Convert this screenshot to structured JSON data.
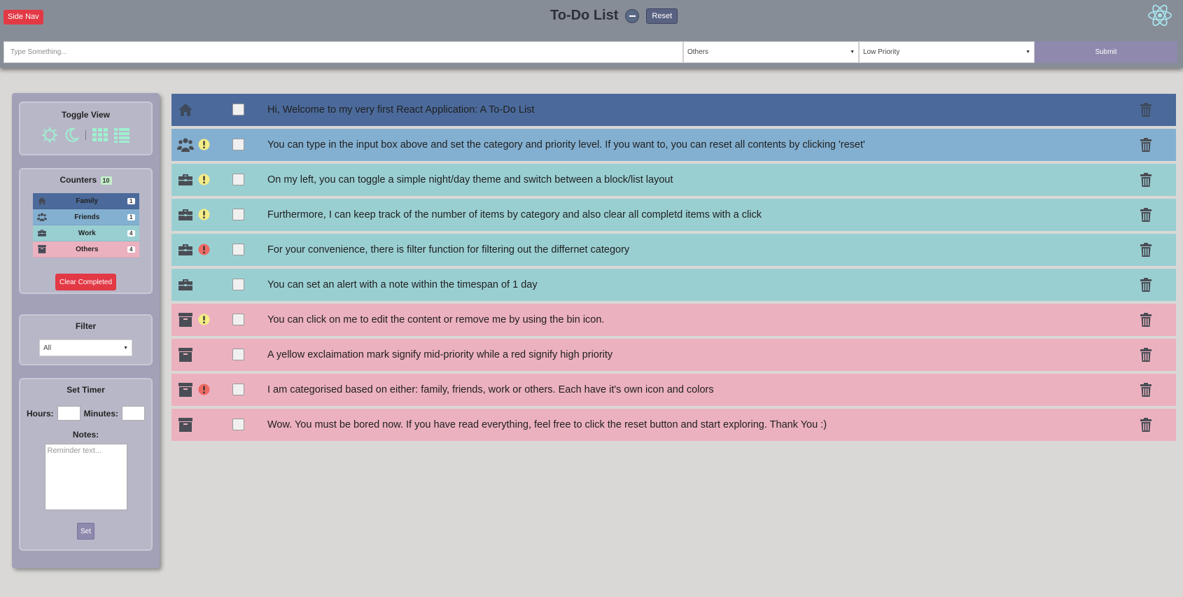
{
  "header": {
    "side_nav_label": "Side Nav",
    "title": "To-Do List",
    "reset_label": "Reset"
  },
  "input_bar": {
    "placeholder": "Type Something...",
    "category_selected": "Others",
    "priority_selected": "Low Priority",
    "submit_label": "Submit"
  },
  "sidebar": {
    "toggle_view": {
      "title": "Toggle View"
    },
    "counters": {
      "title": "Counters",
      "total": "10",
      "categories": [
        {
          "name": "Family",
          "count": "1",
          "color": "#4b6a9b",
          "icon": "home-icon"
        },
        {
          "name": "Friends",
          "count": "1",
          "color": "#83b0d1",
          "icon": "users-icon"
        },
        {
          "name": "Work",
          "count": "4",
          "color": "#9acfd2",
          "icon": "briefcase-icon"
        },
        {
          "name": "Others",
          "count": "4",
          "color": "#ecb1bf",
          "icon": "archive-icon"
        }
      ],
      "clear_label": "Clear Completed"
    },
    "filter": {
      "title": "Filter",
      "selected": "All"
    },
    "timer": {
      "title": "Set Timer",
      "hours_label": "Hours:",
      "minutes_label": "Minutes:",
      "notes_label": "Notes:",
      "notes_placeholder": "Reminder text...",
      "set_label": "Set"
    }
  },
  "colors": {
    "family": "#4b6a9b",
    "friends": "#83b0d1",
    "work": "#9acfd2",
    "others": "#ecb1bf",
    "mid_priority": "#f4ec86",
    "high_priority": "#ee6b64",
    "accent_teal": "#9ff0d0",
    "danger": "#e23945"
  },
  "todos": [
    {
      "category": "family",
      "priority": "low",
      "text": "Hi, Welcome to my very first React Application: A To-Do List"
    },
    {
      "category": "friends",
      "priority": "mid",
      "text": "You can type in the input box above and set the category and priority level. If you want to, you can reset all contents by clicking 'reset'"
    },
    {
      "category": "work",
      "priority": "mid",
      "text": "On my left, you can toggle a simple night/day theme and switch between a block/list layout"
    },
    {
      "category": "work",
      "priority": "mid",
      "text": "Furthermore, I can keep track of the number of items by category and also clear all completd items with a click"
    },
    {
      "category": "work",
      "priority": "high",
      "text": "For your convenience, there is filter function for filtering out the differnet category"
    },
    {
      "category": "work",
      "priority": "low",
      "text": "You can set an alert with a note within the timespan of 1 day"
    },
    {
      "category": "others",
      "priority": "mid",
      "text": "You can click on me to edit the content or remove me by using the bin icon."
    },
    {
      "category": "others",
      "priority": "low",
      "text": "A yellow exclaimation mark signify mid-priority while a red signify high priority"
    },
    {
      "category": "others",
      "priority": "high",
      "text": "I am categorised based on either: family, friends, work or others. Each have it's own icon and colors"
    },
    {
      "category": "others",
      "priority": "low",
      "text": "Wow. You must be bored now. If you have read everything, feel free to click the reset button and start exploring. Thank You :)"
    }
  ]
}
